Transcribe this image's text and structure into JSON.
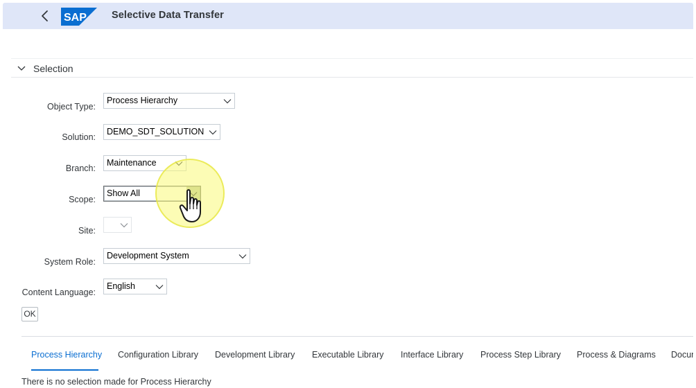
{
  "shell": {
    "title": "Selective Data Transfer",
    "logo_text": "SAP",
    "back_icon": "chevron-left-icon",
    "colors": {
      "shellbar_bg": "#dfe6f8",
      "logo_blue": "#0a6ed1",
      "accent": "#0a6ed1"
    }
  },
  "section": {
    "title": "Selection",
    "toggle_icon": "chevron-down-icon"
  },
  "form": {
    "object_type": {
      "label": "Object Type:",
      "value": "Process Hierarchy"
    },
    "solution": {
      "label": "Solution:",
      "value": "DEMO_SDT_SOLUTION"
    },
    "branch": {
      "label": "Branch:",
      "value": "Maintenance"
    },
    "scope": {
      "label": "Scope:",
      "value": "Show All"
    },
    "site": {
      "label": "Site:",
      "value": ""
    },
    "system_role": {
      "label": "System Role:",
      "value": "Development System"
    },
    "content_language": {
      "label": "Content Language:",
      "value": "English"
    },
    "ok_label": "OK"
  },
  "tabs": [
    {
      "label": "Process Hierarchy",
      "active": true
    },
    {
      "label": "Configuration Library"
    },
    {
      "label": "Development Library"
    },
    {
      "label": "Executable Library"
    },
    {
      "label": "Interface Library"
    },
    {
      "label": "Process Step Library"
    },
    {
      "label": "Process & Diagrams"
    },
    {
      "label": "Docun"
    }
  ],
  "message": "There is no selection made for Process Hierarchy",
  "overlay": {
    "cursor_icon": "hand-pointer-icon",
    "highlight": "click-highlight"
  }
}
